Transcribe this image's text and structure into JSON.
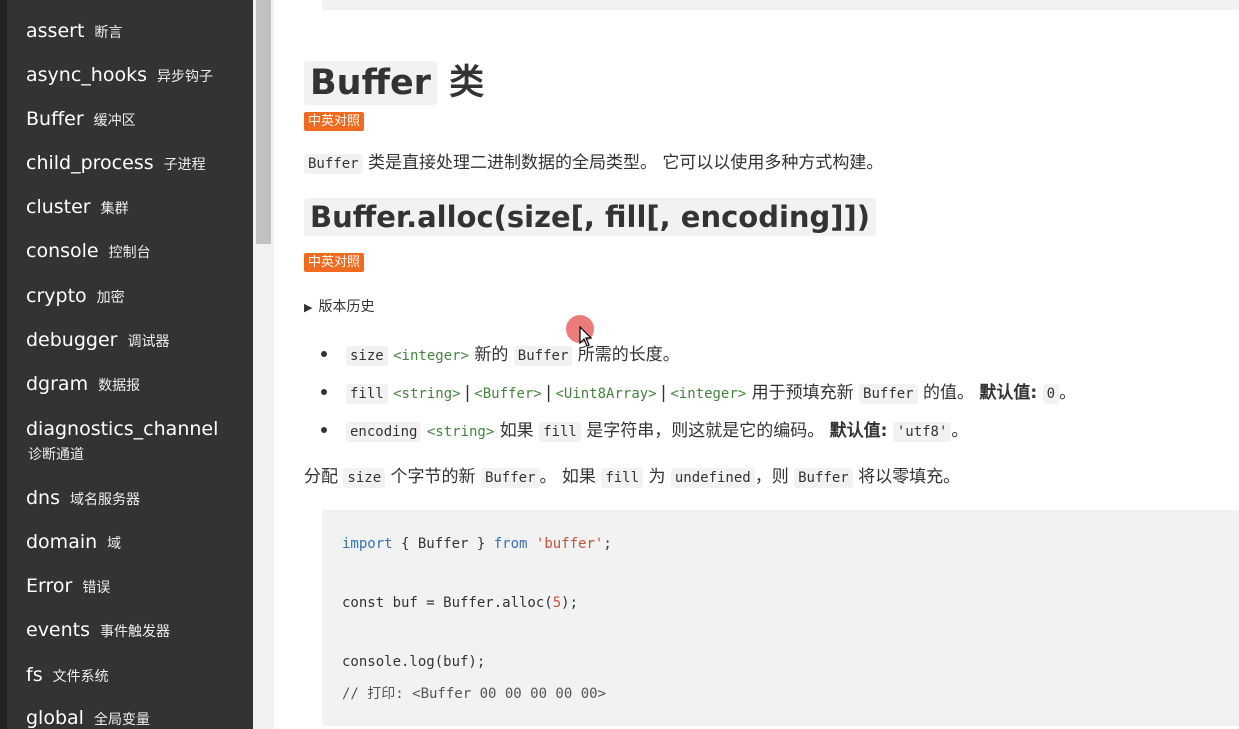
{
  "sidebar": {
    "items": [
      {
        "en": "assert",
        "zh": "断言"
      },
      {
        "en": "async_hooks",
        "zh": "异步钩子"
      },
      {
        "en": "Buffer",
        "zh": "缓冲区"
      },
      {
        "en": "child_process",
        "zh": "子进程"
      },
      {
        "en": "cluster",
        "zh": "集群"
      },
      {
        "en": "console",
        "zh": "控制台"
      },
      {
        "en": "crypto",
        "zh": "加密"
      },
      {
        "en": "debugger",
        "zh": "调试器"
      },
      {
        "en": "dgram",
        "zh": "数据报"
      },
      {
        "en": "diagnostics_channel",
        "zh": "诊断通道"
      },
      {
        "en": "dns",
        "zh": "域名服务器"
      },
      {
        "en": "domain",
        "zh": "域"
      },
      {
        "en": "Error",
        "zh": "错误"
      },
      {
        "en": "events",
        "zh": "事件触发器"
      },
      {
        "en": "fs",
        "zh": "文件系统"
      },
      {
        "en": "global",
        "zh": "全局变量"
      }
    ]
  },
  "content": {
    "class_heading": {
      "code": "Buffer",
      "suffix": "类"
    },
    "badge": "中英对照",
    "class_desc": {
      "code": "Buffer",
      "text": "类是直接处理二进制数据的全局类型。 它可以以使用多种方式构建。"
    },
    "method_heading": "Buffer.alloc(size[, fill[, encoding]])",
    "method_badge": "中英对照",
    "history": "版本历史",
    "params": [
      {
        "name": "size",
        "types": [
          "<integer>"
        ],
        "t1": "新的",
        "c1": "Buffer",
        "t2": "所需的长度。"
      },
      {
        "name": "fill",
        "types": [
          "<string>",
          "<Buffer>",
          "<Uint8Array>",
          "<integer>"
        ],
        "t1": "用于预填充新",
        "c1": "Buffer",
        "t2": "的值。",
        "default_label": "默认值:",
        "default_value": "0",
        "end": "。"
      },
      {
        "name": "encoding",
        "types": [
          "<string>"
        ],
        "t1": "如果",
        "c1": "fill",
        "t2": "是字符串，则这就是它的编码。",
        "default_label": "默认值:",
        "default_value": "'utf8'",
        "end": "。"
      }
    ],
    "summary": {
      "p1": "分配",
      "c1": "size",
      "p2": "个字节的新",
      "c2": "Buffer",
      "p3": "。 如果",
      "c3": "fill",
      "p4": "为",
      "c4": "undefined",
      "p5": "，则",
      "c5": "Buffer",
      "p6": "将以零填充。"
    },
    "code": {
      "l1_kw": "import",
      "l1_mid": " { Buffer } ",
      "l1_from": "from",
      "l1_str": "'buffer'",
      "l1_end": ";",
      "l2_a": "const buf = Buffer.alloc(",
      "l2_num": "5",
      "l2_b": ");",
      "l3": "console.log(buf);",
      "l4": "// 打印: <Buffer 00 00 00 00 00>"
    }
  }
}
